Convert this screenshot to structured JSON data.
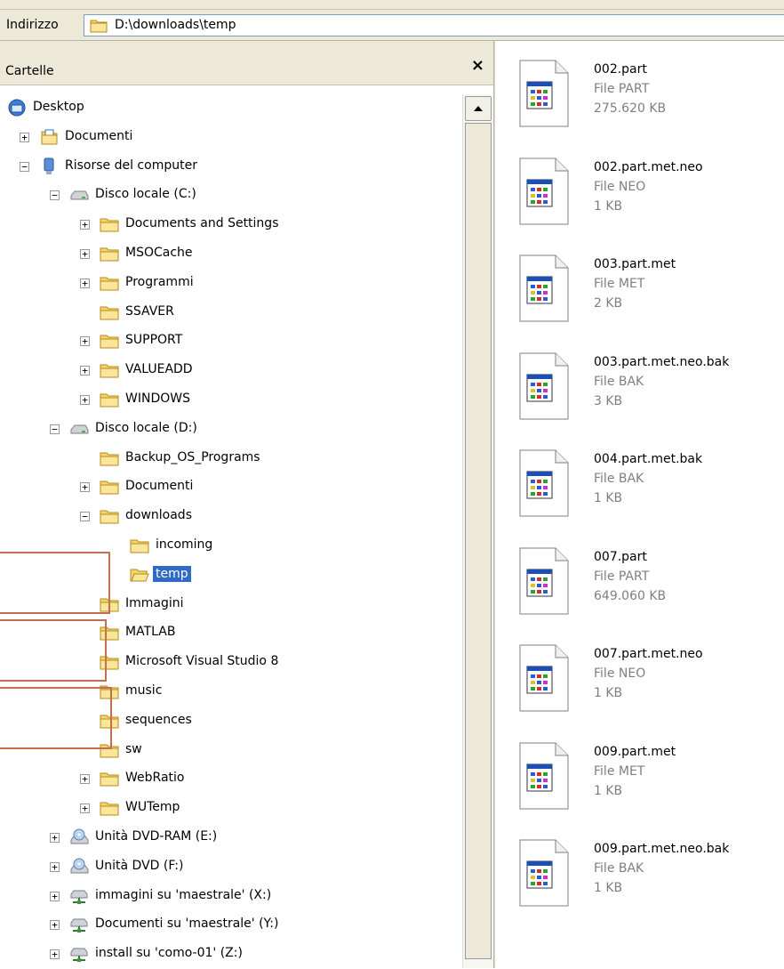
{
  "address_bar": {
    "label": "Indirizzo",
    "value": "D:\\downloads\\temp"
  },
  "folders_pane": {
    "title": "Cartelle",
    "close_symbol": "×"
  },
  "tree": [
    {
      "label": "Desktop",
      "level": 0,
      "expander": "",
      "icon": "desktop-icon"
    },
    {
      "label": "Documenti",
      "level": 1,
      "expander": "+",
      "icon": "my-documents-icon"
    },
    {
      "label": "Risorse del computer",
      "level": 1,
      "expander": "−",
      "icon": "my-computer-icon"
    },
    {
      "label": "Disco locale (C:)",
      "level": 2,
      "expander": "−",
      "icon": "drive-icon"
    },
    {
      "label": "Documents and Settings",
      "level": 3,
      "expander": "+",
      "icon": "folder-icon"
    },
    {
      "label": "MSOCache",
      "level": 3,
      "expander": "+",
      "icon": "folder-icon"
    },
    {
      "label": "Programmi",
      "level": 3,
      "expander": "+",
      "icon": "folder-icon"
    },
    {
      "label": "SSAVER",
      "level": 3,
      "expander": "",
      "icon": "folder-icon"
    },
    {
      "label": "SUPPORT",
      "level": 3,
      "expander": "+",
      "icon": "folder-icon"
    },
    {
      "label": "VALUEADD",
      "level": 3,
      "expander": "+",
      "icon": "folder-icon"
    },
    {
      "label": "WINDOWS",
      "level": 3,
      "expander": "+",
      "icon": "folder-icon"
    },
    {
      "label": "Disco locale (D:)",
      "level": 2,
      "expander": "−",
      "icon": "drive-icon"
    },
    {
      "label": "Backup_OS_Programs",
      "level": 3,
      "expander": "",
      "icon": "folder-icon"
    },
    {
      "label": "Documenti",
      "level": 3,
      "expander": "+",
      "icon": "folder-icon"
    },
    {
      "label": "downloads",
      "level": 3,
      "expander": "−",
      "icon": "folder-icon"
    },
    {
      "label": "incoming",
      "level": 4,
      "expander": "",
      "icon": "folder-icon"
    },
    {
      "label": "temp",
      "level": 4,
      "expander": "",
      "icon": "open-folder-icon",
      "selected": true
    },
    {
      "label": "Immagini",
      "level": 3,
      "expander": "",
      "icon": "folder-icon"
    },
    {
      "label": "MATLAB",
      "level": 3,
      "expander": "",
      "icon": "folder-icon"
    },
    {
      "label": "Microsoft Visual Studio 8",
      "level": 3,
      "expander": "",
      "icon": "folder-icon"
    },
    {
      "label": "music",
      "level": 3,
      "expander": "",
      "icon": "folder-icon"
    },
    {
      "label": "sequences",
      "level": 3,
      "expander": "",
      "icon": "folder-icon"
    },
    {
      "label": "sw",
      "level": 3,
      "expander": "",
      "icon": "folder-icon"
    },
    {
      "label": "WebRatio",
      "level": 3,
      "expander": "+",
      "icon": "folder-icon"
    },
    {
      "label": "WUTemp",
      "level": 3,
      "expander": "+",
      "icon": "folder-icon"
    },
    {
      "label": "Unità DVD-RAM (E:)",
      "level": 2,
      "expander": "+",
      "icon": "dvd-drive-icon"
    },
    {
      "label": "Unità DVD (F:)",
      "level": 2,
      "expander": "+",
      "icon": "dvd-drive-icon"
    },
    {
      "label": "immagini su 'maestrale' (X:)",
      "level": 2,
      "expander": "+",
      "icon": "network-drive-icon"
    },
    {
      "label": "Documenti su 'maestrale' (Y:)",
      "level": 2,
      "expander": "+",
      "icon": "network-drive-icon"
    },
    {
      "label": "install su 'como-01' (Z:)",
      "level": 2,
      "expander": "+",
      "icon": "network-drive-icon"
    }
  ],
  "files": [
    {
      "name": "002.part",
      "type": "File PART",
      "size": "275.620 KB"
    },
    {
      "name": "002.part.met.neo",
      "type": "File NEO",
      "size": "1 KB"
    },
    {
      "name": "003.part.met",
      "type": "File MET",
      "size": "2 KB"
    },
    {
      "name": "003.part.met.neo.bak",
      "type": "File BAK",
      "size": "3 KB"
    },
    {
      "name": "004.part.met.bak",
      "type": "File BAK",
      "size": "1 KB"
    },
    {
      "name": "007.part",
      "type": "File PART",
      "size": "649.060 KB"
    },
    {
      "name": "007.part.met.neo",
      "type": "File NEO",
      "size": "1 KB"
    },
    {
      "name": "009.part.met",
      "type": "File MET",
      "size": "1 KB"
    },
    {
      "name": "009.part.met.neo.bak",
      "type": "File BAK",
      "size": "1 KB"
    }
  ],
  "colors": {
    "selection": "#316ac5",
    "annotation_border": "#c0704d",
    "chrome": "#ece9d8",
    "folder": "#f5d66b"
  }
}
